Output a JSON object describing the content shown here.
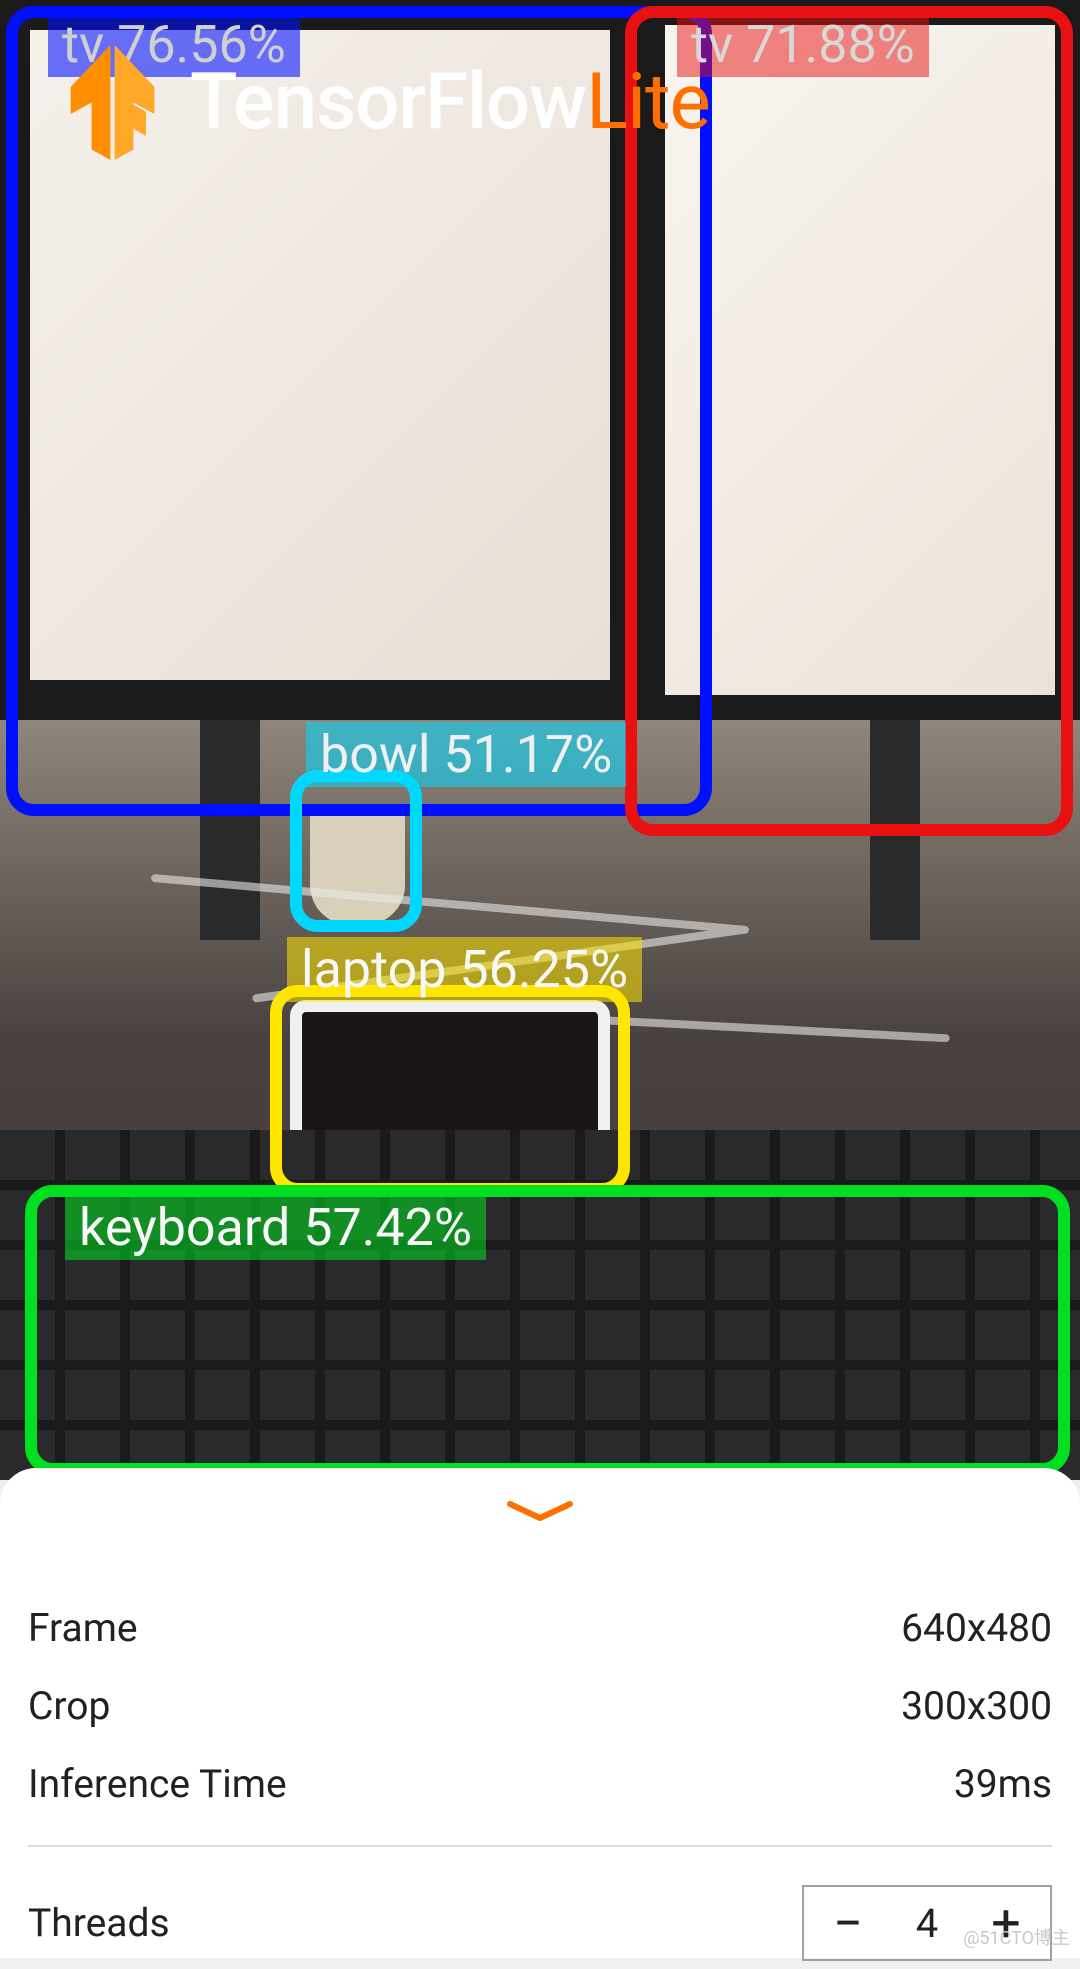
{
  "logo": {
    "tensor": "TensorFlow",
    "lite": "Lite"
  },
  "detections": {
    "tv1": {
      "class": "tv",
      "confidence": "76.56%"
    },
    "tv2": {
      "class": "tv",
      "confidence": "71.88%"
    },
    "bowl": {
      "class": "bowl",
      "confidence": "51.17%"
    },
    "laptop": {
      "class": "laptop",
      "confidence": "56.25%"
    },
    "keyboard": {
      "class": "keyboard",
      "confidence": "57.42%"
    }
  },
  "stats": {
    "frame_label": "Frame",
    "frame_value": "640x480",
    "crop_label": "Crop",
    "crop_value": "300x300",
    "inference_label": "Inference Time",
    "inference_value": "39ms"
  },
  "threads": {
    "label": "Threads",
    "value": "4",
    "minus": "−",
    "plus": "+"
  },
  "colors": {
    "accent": "#ff6f00",
    "tv1_box": "#0010ff",
    "tv2_box": "#e81010",
    "bowl_box": "#00d8ff",
    "laptop_box": "#ffe600",
    "keyboard_box": "#00e020"
  },
  "watermark": "@51CTO博主"
}
